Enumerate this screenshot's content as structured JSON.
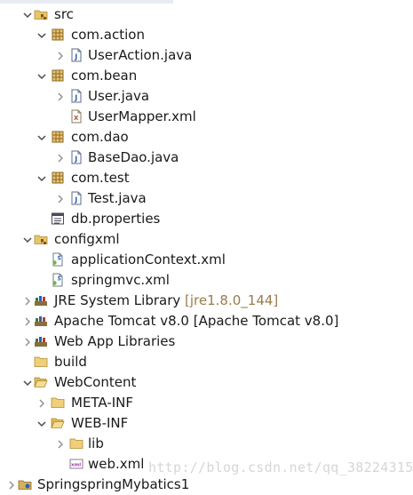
{
  "tree": [
    {
      "id": "src",
      "label": "src",
      "icon": "source-folder-icon",
      "toggle": "expanded",
      "level": 0
    },
    {
      "id": "pkg-com-action",
      "label": "com.action",
      "icon": "package-icon",
      "toggle": "expanded",
      "level": 1
    },
    {
      "id": "file-useraction",
      "label": "UserAction.java",
      "icon": "java-file-icon",
      "toggle": "collapsed",
      "level": 2
    },
    {
      "id": "pkg-com-bean",
      "label": "com.bean",
      "icon": "package-icon",
      "toggle": "expanded",
      "level": 1
    },
    {
      "id": "file-user",
      "label": "User.java",
      "icon": "java-file-icon",
      "toggle": "collapsed",
      "level": 2
    },
    {
      "id": "file-usermapper",
      "label": "UserMapper.xml",
      "icon": "xml-file-icon",
      "toggle": "none",
      "level": 2
    },
    {
      "id": "pkg-com-dao",
      "label": "com.dao",
      "icon": "package-icon",
      "toggle": "expanded",
      "level": 1
    },
    {
      "id": "file-basedao",
      "label": "BaseDao.java",
      "icon": "java-file-icon",
      "toggle": "collapsed",
      "level": 2
    },
    {
      "id": "pkg-com-test",
      "label": "com.test",
      "icon": "package-icon",
      "toggle": "expanded",
      "level": 1
    },
    {
      "id": "file-test",
      "label": "Test.java",
      "icon": "java-file-icon",
      "toggle": "collapsed",
      "level": 2
    },
    {
      "id": "file-db-properties",
      "label": "db.properties",
      "icon": "properties-file-icon",
      "toggle": "none",
      "level": 1
    },
    {
      "id": "configxml",
      "label": "configxml",
      "icon": "source-folder-icon",
      "toggle": "expanded",
      "level": 0
    },
    {
      "id": "file-appcontext",
      "label": "applicationContext.xml",
      "icon": "spring-xml-file-icon",
      "toggle": "none",
      "level": 1
    },
    {
      "id": "file-springmvc",
      "label": "springmvc.xml",
      "icon": "spring-xml-file-icon",
      "toggle": "none",
      "level": 1
    },
    {
      "id": "lib-jre",
      "label": "JRE System Library",
      "decoration": "[jre1.8.0_144]",
      "icon": "library-icon",
      "toggle": "collapsed",
      "level": 0
    },
    {
      "id": "lib-tomcat",
      "label": "Apache Tomcat v8.0 [Apache Tomcat v8.0]",
      "icon": "library-icon",
      "toggle": "collapsed",
      "level": 0
    },
    {
      "id": "lib-webapp",
      "label": "Web App Libraries",
      "icon": "library-icon",
      "toggle": "collapsed",
      "level": 0
    },
    {
      "id": "folder-build",
      "label": "build",
      "icon": "folder-icon",
      "toggle": "none",
      "level": 0
    },
    {
      "id": "folder-webcontent",
      "label": "WebContent",
      "icon": "open-folder-icon",
      "toggle": "expanded",
      "level": 0
    },
    {
      "id": "folder-meta-inf",
      "label": "META-INF",
      "icon": "folder-icon",
      "toggle": "collapsed",
      "level": 1
    },
    {
      "id": "folder-web-inf",
      "label": "WEB-INF",
      "icon": "open-folder-icon",
      "toggle": "expanded",
      "level": 1
    },
    {
      "id": "folder-lib",
      "label": "lib",
      "icon": "folder-icon",
      "toggle": "collapsed",
      "level": 2
    },
    {
      "id": "file-web-xml",
      "label": "web.xml",
      "icon": "web-xml-file-icon",
      "toggle": "none",
      "level": 2
    },
    {
      "id": "project-next",
      "label": "SpringspringMybatics1",
      "icon": "project-icon",
      "toggle": "collapsed",
      "level": -1
    }
  ],
  "watermark": "http://blog.csdn.net/qq_38224315",
  "colors": {
    "toggle": "#4a4a4a",
    "decoration": "#9a7c4b",
    "package": "#8c6a1f",
    "java": "#2c5fb8"
  }
}
